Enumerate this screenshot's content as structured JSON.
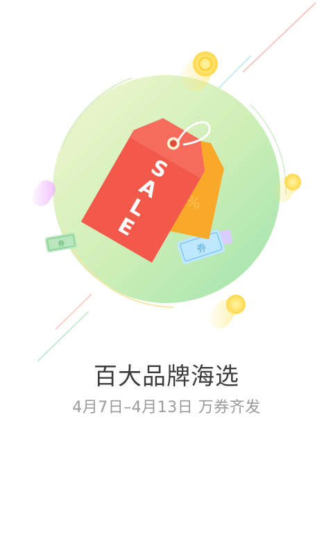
{
  "splash": {
    "headline": "百大品牌海选",
    "subline": "4月7日–4月13日 万券齐发"
  },
  "artwork": {
    "tag_text": [
      "S",
      "A",
      "L",
      "E"
    ],
    "back_tag_text": "%",
    "coupon_text": "券"
  },
  "colors": {
    "circle_light": "#eef6c9",
    "circle_dark": "#a9e7b4",
    "tag_front": "#f25b4d",
    "tag_back": "#f7a323",
    "coin": "#ffd54a"
  },
  "icons": {
    "hero": "sale-tag-icon"
  }
}
